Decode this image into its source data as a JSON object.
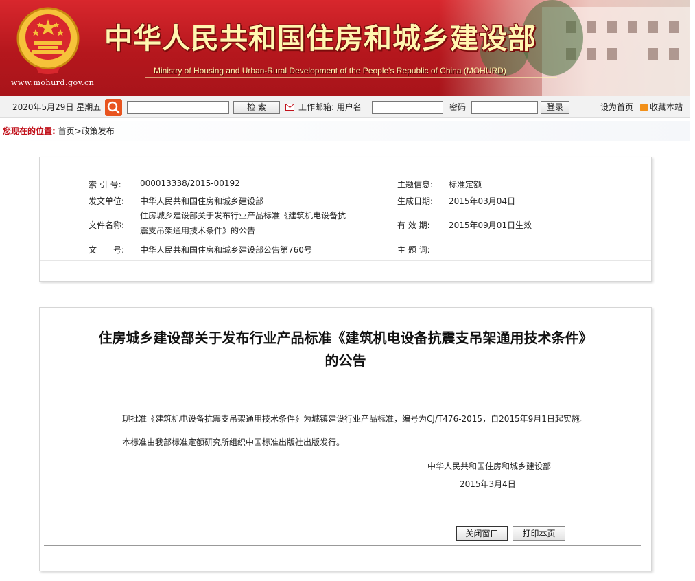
{
  "colors": {
    "brand_red": "#b5171d",
    "title_yellow": "#fff6b0",
    "breadcrumb_red": "#c1121c"
  },
  "header": {
    "site_title": "中华人民共和国住房和城乡建设部",
    "site_subtitle": "Ministry of Housing and Urban-Rural Development of the People's Republic of China (MOHURD)",
    "site_url": "www.mohurd.gov.cn"
  },
  "toolbar": {
    "date": "2020年5月29日 星期五",
    "search_button": "检  索",
    "mail_label": "工作邮箱: 用户名",
    "password_label": "密码",
    "login_button": "登录",
    "set_homepage": "设为首页",
    "bookmark": "收藏本站"
  },
  "breadcrumb": {
    "label": "您现在的位置:",
    "home": "首页",
    "separator": ">",
    "current": "政策发布"
  },
  "info": {
    "index_label": "索 引 号:",
    "index_value": "000013338/2015-00192",
    "issuer_label": "发文单位:",
    "issuer_value": "中华人民共和国住房和城乡建设部",
    "name_label": "文件名称:",
    "name_value": "住房城乡建设部关于发布行业产品标准《建筑机电设备抗震支吊架通用技术条件》的公告",
    "docno_label": "文　　号:",
    "docno_value": "中华人民共和国住房和城乡建设部公告第760号",
    "topic_label": "主题信息:",
    "topic_value": "标准定额",
    "date_label": "生成日期:",
    "date_value": "2015年03月04日",
    "valid_label": "有 效 期:",
    "valid_value": "2015年09月01日生效",
    "keywords_label": "主 题 词:",
    "keywords_value": ""
  },
  "document": {
    "title_line1": "住房城乡建设部关于发布行业产品标准《建筑机电设备抗震支吊架通用技术条件》",
    "title_line2": "的公告",
    "para1": "现批准《建筑机电设备抗震支吊架通用技术条件》为城镇建设行业产品标准，编号为CJ/T476-2015，自2015年9月1日起实施。",
    "para2": "本标准由我部标准定额研究所组织中国标准出版社出版发行。",
    "signature": "中华人民共和国住房和城乡建设部",
    "sign_date": "2015年3月4日",
    "close_button": "关闭窗口",
    "print_button": "打印本页"
  }
}
